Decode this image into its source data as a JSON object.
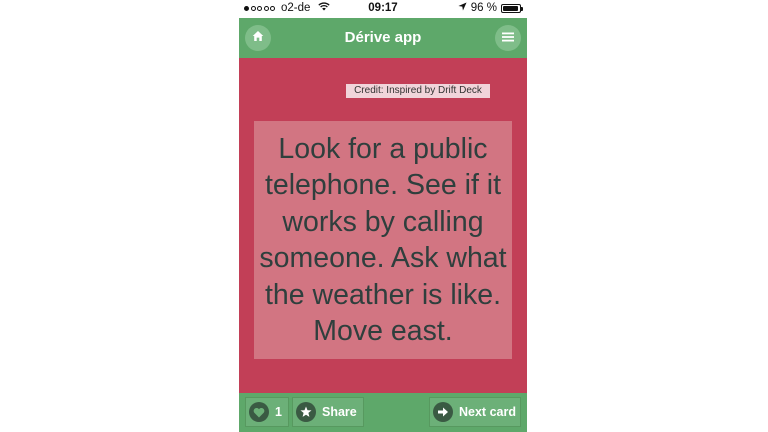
{
  "status_bar": {
    "carrier": "o2-de",
    "time": "09:17",
    "battery_text": "96 %",
    "battery_level": 0.96,
    "signal_bars_filled": 1,
    "signal_bars_total": 5
  },
  "header": {
    "title": "Dérive app",
    "home_icon": "home-icon",
    "menu_icon": "hamburger-menu-icon"
  },
  "credit": "Credit: Inspired by Drift Deck",
  "card": {
    "text": "Look for a public telephone. See if it works by calling someone. Ask what the weather is like. Move east."
  },
  "footer": {
    "like_count": "1",
    "share_label": "Share",
    "next_label": "Next card"
  },
  "colors": {
    "header_green": "#5ea86a",
    "background_red": "#c23f57",
    "card_pink": "#d27582",
    "text_dark": "#2f3f3d"
  }
}
